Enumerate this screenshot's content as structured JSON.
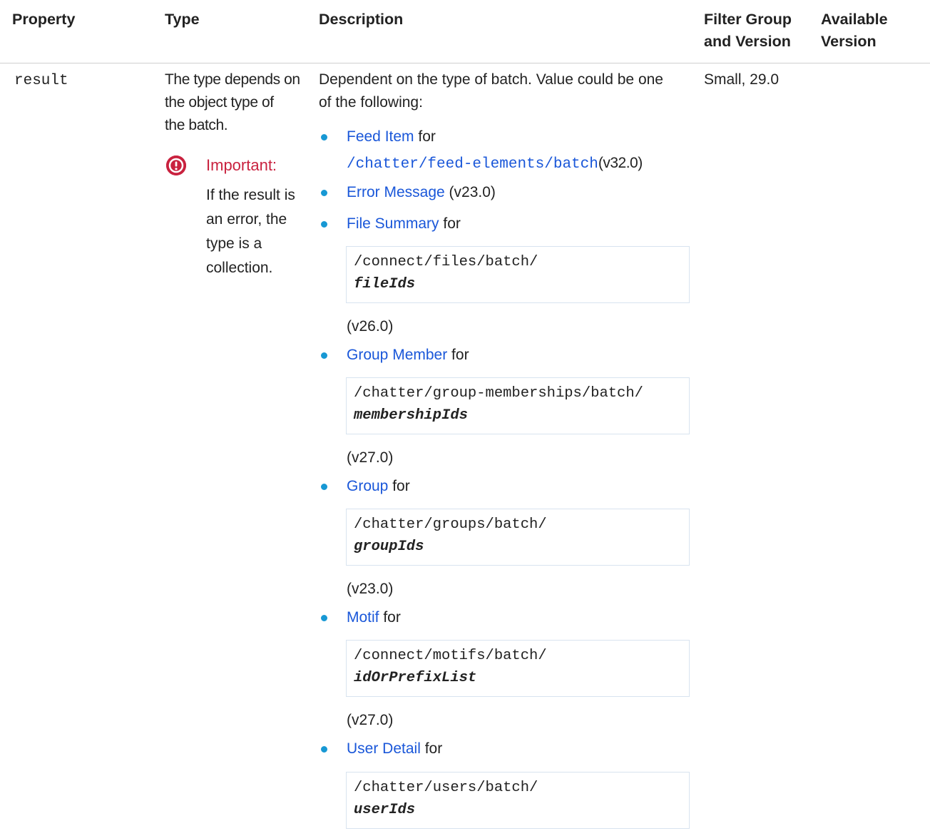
{
  "table": {
    "headers": {
      "property": "Property",
      "type": "Type",
      "description": "Description",
      "filter_group": [
        "Filter Group",
        "and Version"
      ],
      "available_version": [
        "Available",
        "Version"
      ]
    },
    "row": {
      "property": "result",
      "type_text": [
        "The type depends on",
        "the object type of",
        "the batch."
      ],
      "important": {
        "icon": "exclamation-circle-icon",
        "title": "Important:",
        "text": "If the result is an error, the type is a collection."
      },
      "description_intro": [
        "Dependent on the type of batch. Value could be one",
        "of the following:"
      ],
      "filter_group": "Small, 29.0",
      "items": [
        {
          "link": "Feed Item",
          "suffix": " for",
          "path_link": "/chatter/feed-elements/batch",
          "version": "(v32.0)"
        },
        {
          "link": "Error Message",
          "suffix": " (v23.0)"
        },
        {
          "link": "File Summary",
          "suffix": " for",
          "code": "/connect/files/batch/",
          "param": "fileIds",
          "version": "(v26.0)"
        },
        {
          "link": "Group Member",
          "suffix": " for",
          "code": "/chatter/group-memberships/batch/",
          "param": "membershipIds",
          "version": "(v27.0)"
        },
        {
          "link": "Group",
          "suffix": " for",
          "code": "/chatter/groups/batch/",
          "param": "groupIds",
          "version": "(v23.0)"
        },
        {
          "link": "Motif",
          "suffix": " for",
          "code": "/connect/motifs/batch/",
          "param": "idOrPrefixList",
          "version": "(v27.0)"
        },
        {
          "link": "User Detail",
          "suffix": " for",
          "code": "/chatter/users/batch/",
          "param": "userIds"
        }
      ]
    }
  },
  "colors": {
    "link": "#1a57d9",
    "bullet": "#1798d4",
    "important": "#c9223f"
  }
}
